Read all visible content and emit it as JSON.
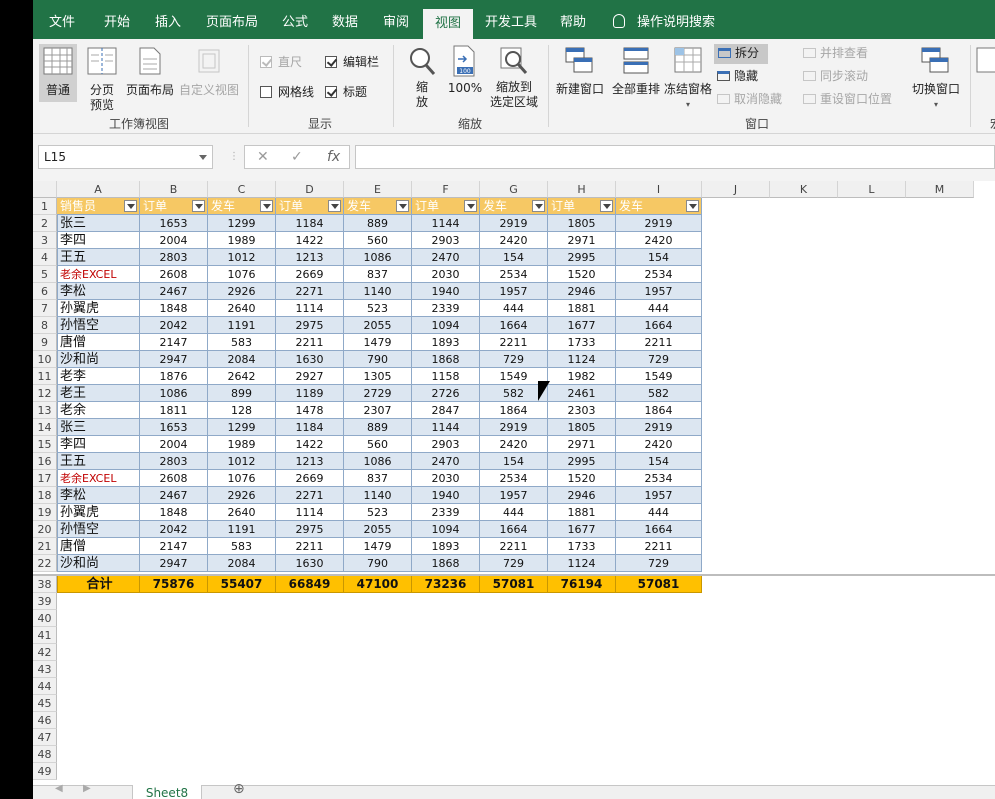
{
  "tabs": [
    "文件",
    "开始",
    "插入",
    "页面布局",
    "公式",
    "数据",
    "审阅",
    "视图",
    "开发工具",
    "帮助",
    "操作说明搜索"
  ],
  "active_tab": "视图",
  "ribbon": {
    "workbook_views": {
      "label": "工作簿视图",
      "normal": "普通",
      "page_break_line1": "分页",
      "page_break_line2": "预览",
      "page_layout": "页面布局",
      "custom": "自定义视图"
    },
    "show": {
      "label": "显示",
      "ruler": "直尺",
      "formula_bar": "编辑栏",
      "gridlines": "网格线",
      "headings": "标题"
    },
    "zoom": {
      "label": "缩放",
      "zoom_line1": "缩",
      "zoom_line2": "放",
      "hundred": "100%",
      "fit_line1": "缩放到",
      "fit_line2": "选定区域",
      "hundred_badge": "100"
    },
    "window": {
      "label": "窗口",
      "new_window": "新建窗口",
      "arrange_all": "全部重排",
      "freeze": "冻结窗格",
      "split": "拆分",
      "hide": "隐藏",
      "unhide": "取消隐藏",
      "side_by_side": "并排查看",
      "sync_scroll": "同步滚动",
      "reset_pos": "重设窗口位置",
      "switch": "切换窗口"
    },
    "cut_char": "宏"
  },
  "formula_bar": {
    "cell_ref": "L15",
    "value": "",
    "fx": "fx"
  },
  "columns": [
    "A",
    "B",
    "C",
    "D",
    "E",
    "F",
    "G",
    "H",
    "I",
    "J",
    "K",
    "L",
    "M"
  ],
  "header_row": {
    "row": "1",
    "cells": [
      "销售员",
      "订单",
      "发车",
      "订单",
      "发车",
      "订单",
      "发车",
      "订单",
      "发车"
    ]
  },
  "rows": [
    {
      "n": "2",
      "name": "张三",
      "vals": [
        "1653",
        "1299",
        "1184",
        "889",
        "1144",
        "2919",
        "1805",
        "2919"
      ]
    },
    {
      "n": "3",
      "name": "李四",
      "vals": [
        "2004",
        "1989",
        "1422",
        "560",
        "2903",
        "2420",
        "2971",
        "2420"
      ]
    },
    {
      "n": "4",
      "name": "王五",
      "vals": [
        "2803",
        "1012",
        "1213",
        "1086",
        "2470",
        "154",
        "2995",
        "154"
      ]
    },
    {
      "n": "5",
      "name": "老余EXCEL",
      "red": true,
      "vals": [
        "2608",
        "1076",
        "2669",
        "837",
        "2030",
        "2534",
        "1520",
        "2534"
      ]
    },
    {
      "n": "6",
      "name": "李松",
      "vals": [
        "2467",
        "2926",
        "2271",
        "1140",
        "1940",
        "1957",
        "2946",
        "1957"
      ]
    },
    {
      "n": "7",
      "name": "孙翼虎",
      "vals": [
        "1848",
        "2640",
        "1114",
        "523",
        "2339",
        "444",
        "1881",
        "444"
      ]
    },
    {
      "n": "8",
      "name": "孙悟空",
      "vals": [
        "2042",
        "1191",
        "2975",
        "2055",
        "1094",
        "1664",
        "1677",
        "1664"
      ]
    },
    {
      "n": "9",
      "name": "唐僧",
      "vals": [
        "2147",
        "583",
        "2211",
        "1479",
        "1893",
        "2211",
        "1733",
        "2211"
      ]
    },
    {
      "n": "10",
      "name": "沙和尚",
      "vals": [
        "2947",
        "2084",
        "1630",
        "790",
        "1868",
        "729",
        "1124",
        "729"
      ]
    },
    {
      "n": "11",
      "name": "老李",
      "vals": [
        "1876",
        "2642",
        "2927",
        "1305",
        "1158",
        "1549",
        "1982",
        "1549"
      ]
    },
    {
      "n": "12",
      "name": "老王",
      "vals": [
        "1086",
        "899",
        "1189",
        "2729",
        "2726",
        "582",
        "2461",
        "582"
      ]
    },
    {
      "n": "13",
      "name": "老余",
      "vals": [
        "1811",
        "128",
        "1478",
        "2307",
        "2847",
        "1864",
        "2303",
        "1864"
      ]
    },
    {
      "n": "14",
      "name": "张三",
      "vals": [
        "1653",
        "1299",
        "1184",
        "889",
        "1144",
        "2919",
        "1805",
        "2919"
      ]
    },
    {
      "n": "15",
      "name": "李四",
      "vals": [
        "2004",
        "1989",
        "1422",
        "560",
        "2903",
        "2420",
        "2971",
        "2420"
      ]
    },
    {
      "n": "16",
      "name": "王五",
      "vals": [
        "2803",
        "1012",
        "1213",
        "1086",
        "2470",
        "154",
        "2995",
        "154"
      ]
    },
    {
      "n": "17",
      "name": "老余EXCEL",
      "red": true,
      "vals": [
        "2608",
        "1076",
        "2669",
        "837",
        "2030",
        "2534",
        "1520",
        "2534"
      ]
    },
    {
      "n": "18",
      "name": "李松",
      "vals": [
        "2467",
        "2926",
        "2271",
        "1140",
        "1940",
        "1957",
        "2946",
        "1957"
      ]
    },
    {
      "n": "19",
      "name": "孙翼虎",
      "vals": [
        "1848",
        "2640",
        "1114",
        "523",
        "2339",
        "444",
        "1881",
        "444"
      ]
    },
    {
      "n": "20",
      "name": "孙悟空",
      "vals": [
        "2042",
        "1191",
        "2975",
        "2055",
        "1094",
        "1664",
        "1677",
        "1664"
      ]
    },
    {
      "n": "21",
      "name": "唐僧",
      "vals": [
        "2147",
        "583",
        "2211",
        "1479",
        "1893",
        "2211",
        "1733",
        "2211"
      ]
    },
    {
      "n": "22",
      "name": "沙和尚",
      "vals": [
        "2947",
        "2084",
        "1630",
        "790",
        "1868",
        "729",
        "1124",
        "729"
      ]
    }
  ],
  "total_row": {
    "n": "38",
    "label": "合计",
    "vals": [
      "75876",
      "55407",
      "66849",
      "47100",
      "73236",
      "57081",
      "76194",
      "57081"
    ]
  },
  "empty_rows": [
    "39",
    "40",
    "41",
    "42",
    "43",
    "44",
    "45",
    "46",
    "47",
    "48",
    "49"
  ],
  "sheet_tab": "Sheet8",
  "add_sheet": "⊕"
}
